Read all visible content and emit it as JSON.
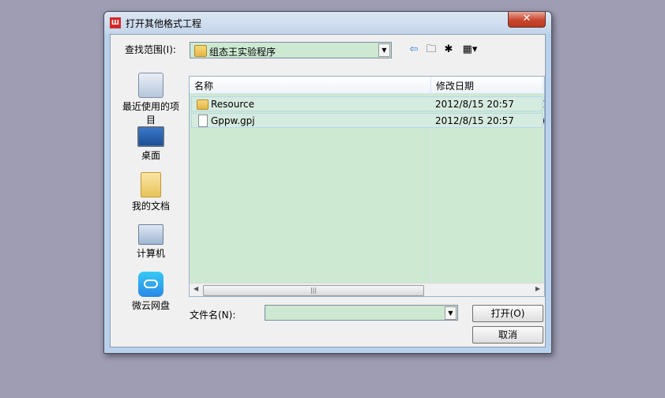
{
  "dialog": {
    "title": "打开其他格式工程",
    "app_icon_text": "Ш",
    "close_symbol": "✕"
  },
  "lookin": {
    "label": "查找范围(I):",
    "value": "组态王实验程序"
  },
  "places": [
    {
      "label": "最近使用的项目",
      "icon": "recent-icon"
    },
    {
      "label": "桌面",
      "icon": "desktop-icon"
    },
    {
      "label": "我的文档",
      "icon": "documents-icon"
    },
    {
      "label": "计算机",
      "icon": "computer-icon"
    },
    {
      "label": "微云网盘",
      "icon": "cloud-drive-icon"
    }
  ],
  "columns": {
    "name": "名称",
    "modified": "修改日期"
  },
  "files": [
    {
      "name": "Resource",
      "date": "2012/8/15 20:57",
      "type": "folder",
      "trunc": "1"
    },
    {
      "name": "Gppw.gpj",
      "date": "2012/8/15 20:57",
      "type": "file",
      "trunc": "("
    }
  ],
  "filename": {
    "label": "文件名(N):",
    "value": ""
  },
  "buttons": {
    "open": "打开(O)",
    "cancel": "取消"
  }
}
